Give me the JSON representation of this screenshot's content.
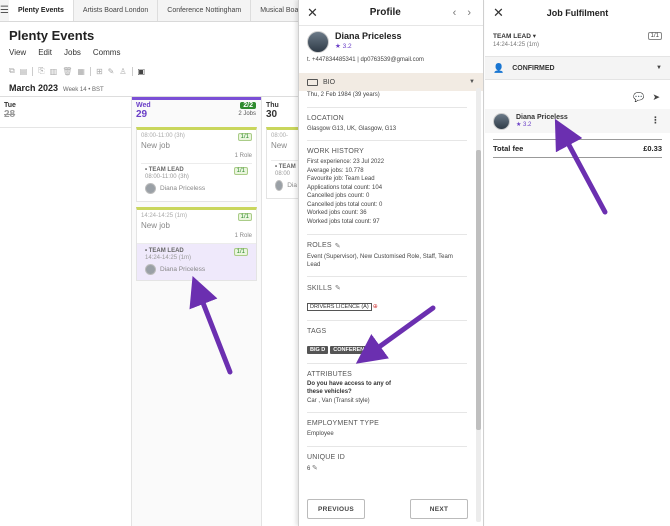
{
  "tabs": [
    {
      "label": "Plenty Events",
      "active": true
    },
    {
      "label": "Artists Board London"
    },
    {
      "label": "Conference Nottingham"
    },
    {
      "label": "Musical Board"
    }
  ],
  "app": {
    "title": "Plenty Events",
    "menu": [
      "View",
      "Edit",
      "Jobs",
      "Comms"
    ],
    "month": "March 2023",
    "week": "Week 14 • BST"
  },
  "calendar": {
    "tue": {
      "name": "Tue",
      "num": "28"
    },
    "wed": {
      "name": "Wed",
      "num": "29",
      "badge": "2/2",
      "count": "2 Jobs",
      "jobs": [
        {
          "time": "08:00-11:00 (3h)",
          "name": "New job",
          "badge": "1/1",
          "roles": "1 Role",
          "shift_title": "• TEAM LEAD",
          "shift_time": "08:00-11:00 (3h)",
          "shift_badge": "1/1",
          "person": "Diana Priceless"
        },
        {
          "time": "14:24-14:25 (1m)",
          "name": "New job",
          "badge": "1/1",
          "roles": "1 Role",
          "shift_title": "• TEAM LEAD",
          "shift_time": "14:24-14:25 (1m)",
          "shift_badge": "1/1",
          "person": "Diana Priceless"
        }
      ]
    },
    "thu": {
      "name": "Thu",
      "num": "30",
      "job": {
        "time": "08:00-",
        "name": "New",
        "shift_title": "• TEAM",
        "shift_time": "08:00",
        "person": "Dia"
      }
    }
  },
  "profile": {
    "title": "Profile",
    "nav": "‹ ›",
    "name": "Diana Priceless",
    "rating": "★ 3.2",
    "contact": "t. +447834485341 | dp0763539@gmail.com",
    "bio_label": "BIO",
    "dob": "Thu, 2 Feb 1984 (39 years)",
    "location": {
      "label": "LOCATION",
      "value": "Glasgow G13, UK, Glasgow, G13"
    },
    "work_history": {
      "label": "WORK HISTORY",
      "lines": [
        "First experience: 23 Jul 2022",
        "Average jobs: 10.778",
        "Favourite job: Team Lead",
        "Applications total count: 104",
        "Cancelled jobs count: 0",
        "Cancelled jobs total count: 0",
        "Worked jobs count: 36",
        "Worked jobs total count: 97"
      ]
    },
    "roles": {
      "label": "ROLES",
      "value": "Event (Supervisor), New Customised Role, Staff, Team Lead"
    },
    "skills": {
      "label": "SKILLS",
      "items": [
        "DRIVERS LICENCE (A)"
      ]
    },
    "tags": {
      "label": "TAGS",
      "items": [
        "BIG D",
        "CONFERENCE"
      ]
    },
    "attributes": {
      "label": "ATTRIBUTES",
      "question": "Do you have access to any of these vehicles?",
      "answer": "Car , Van (Transit style)"
    },
    "employment": {
      "label": "EMPLOYMENT TYPE",
      "value": "Employee"
    },
    "unique_id": {
      "label": "UNIQUE ID",
      "value": "6"
    },
    "prev_label": "PREVIOUS",
    "next_label": "NEXT"
  },
  "fulfilment": {
    "title": "Job Fulfilment",
    "role_label": "TEAM LEAD ▾",
    "role_time": "14:24-14:25 (1m)",
    "role_badge": "1/1",
    "status": "CONFIRMED",
    "person_name": "Diana Priceless",
    "person_rating": "★ 3.2",
    "total_label": "Total fee",
    "total_value": "£0.33"
  },
  "colors": {
    "accent": "#7b4fd6",
    "arrow": "#6b2fb0",
    "success": "#2e8b2e"
  }
}
